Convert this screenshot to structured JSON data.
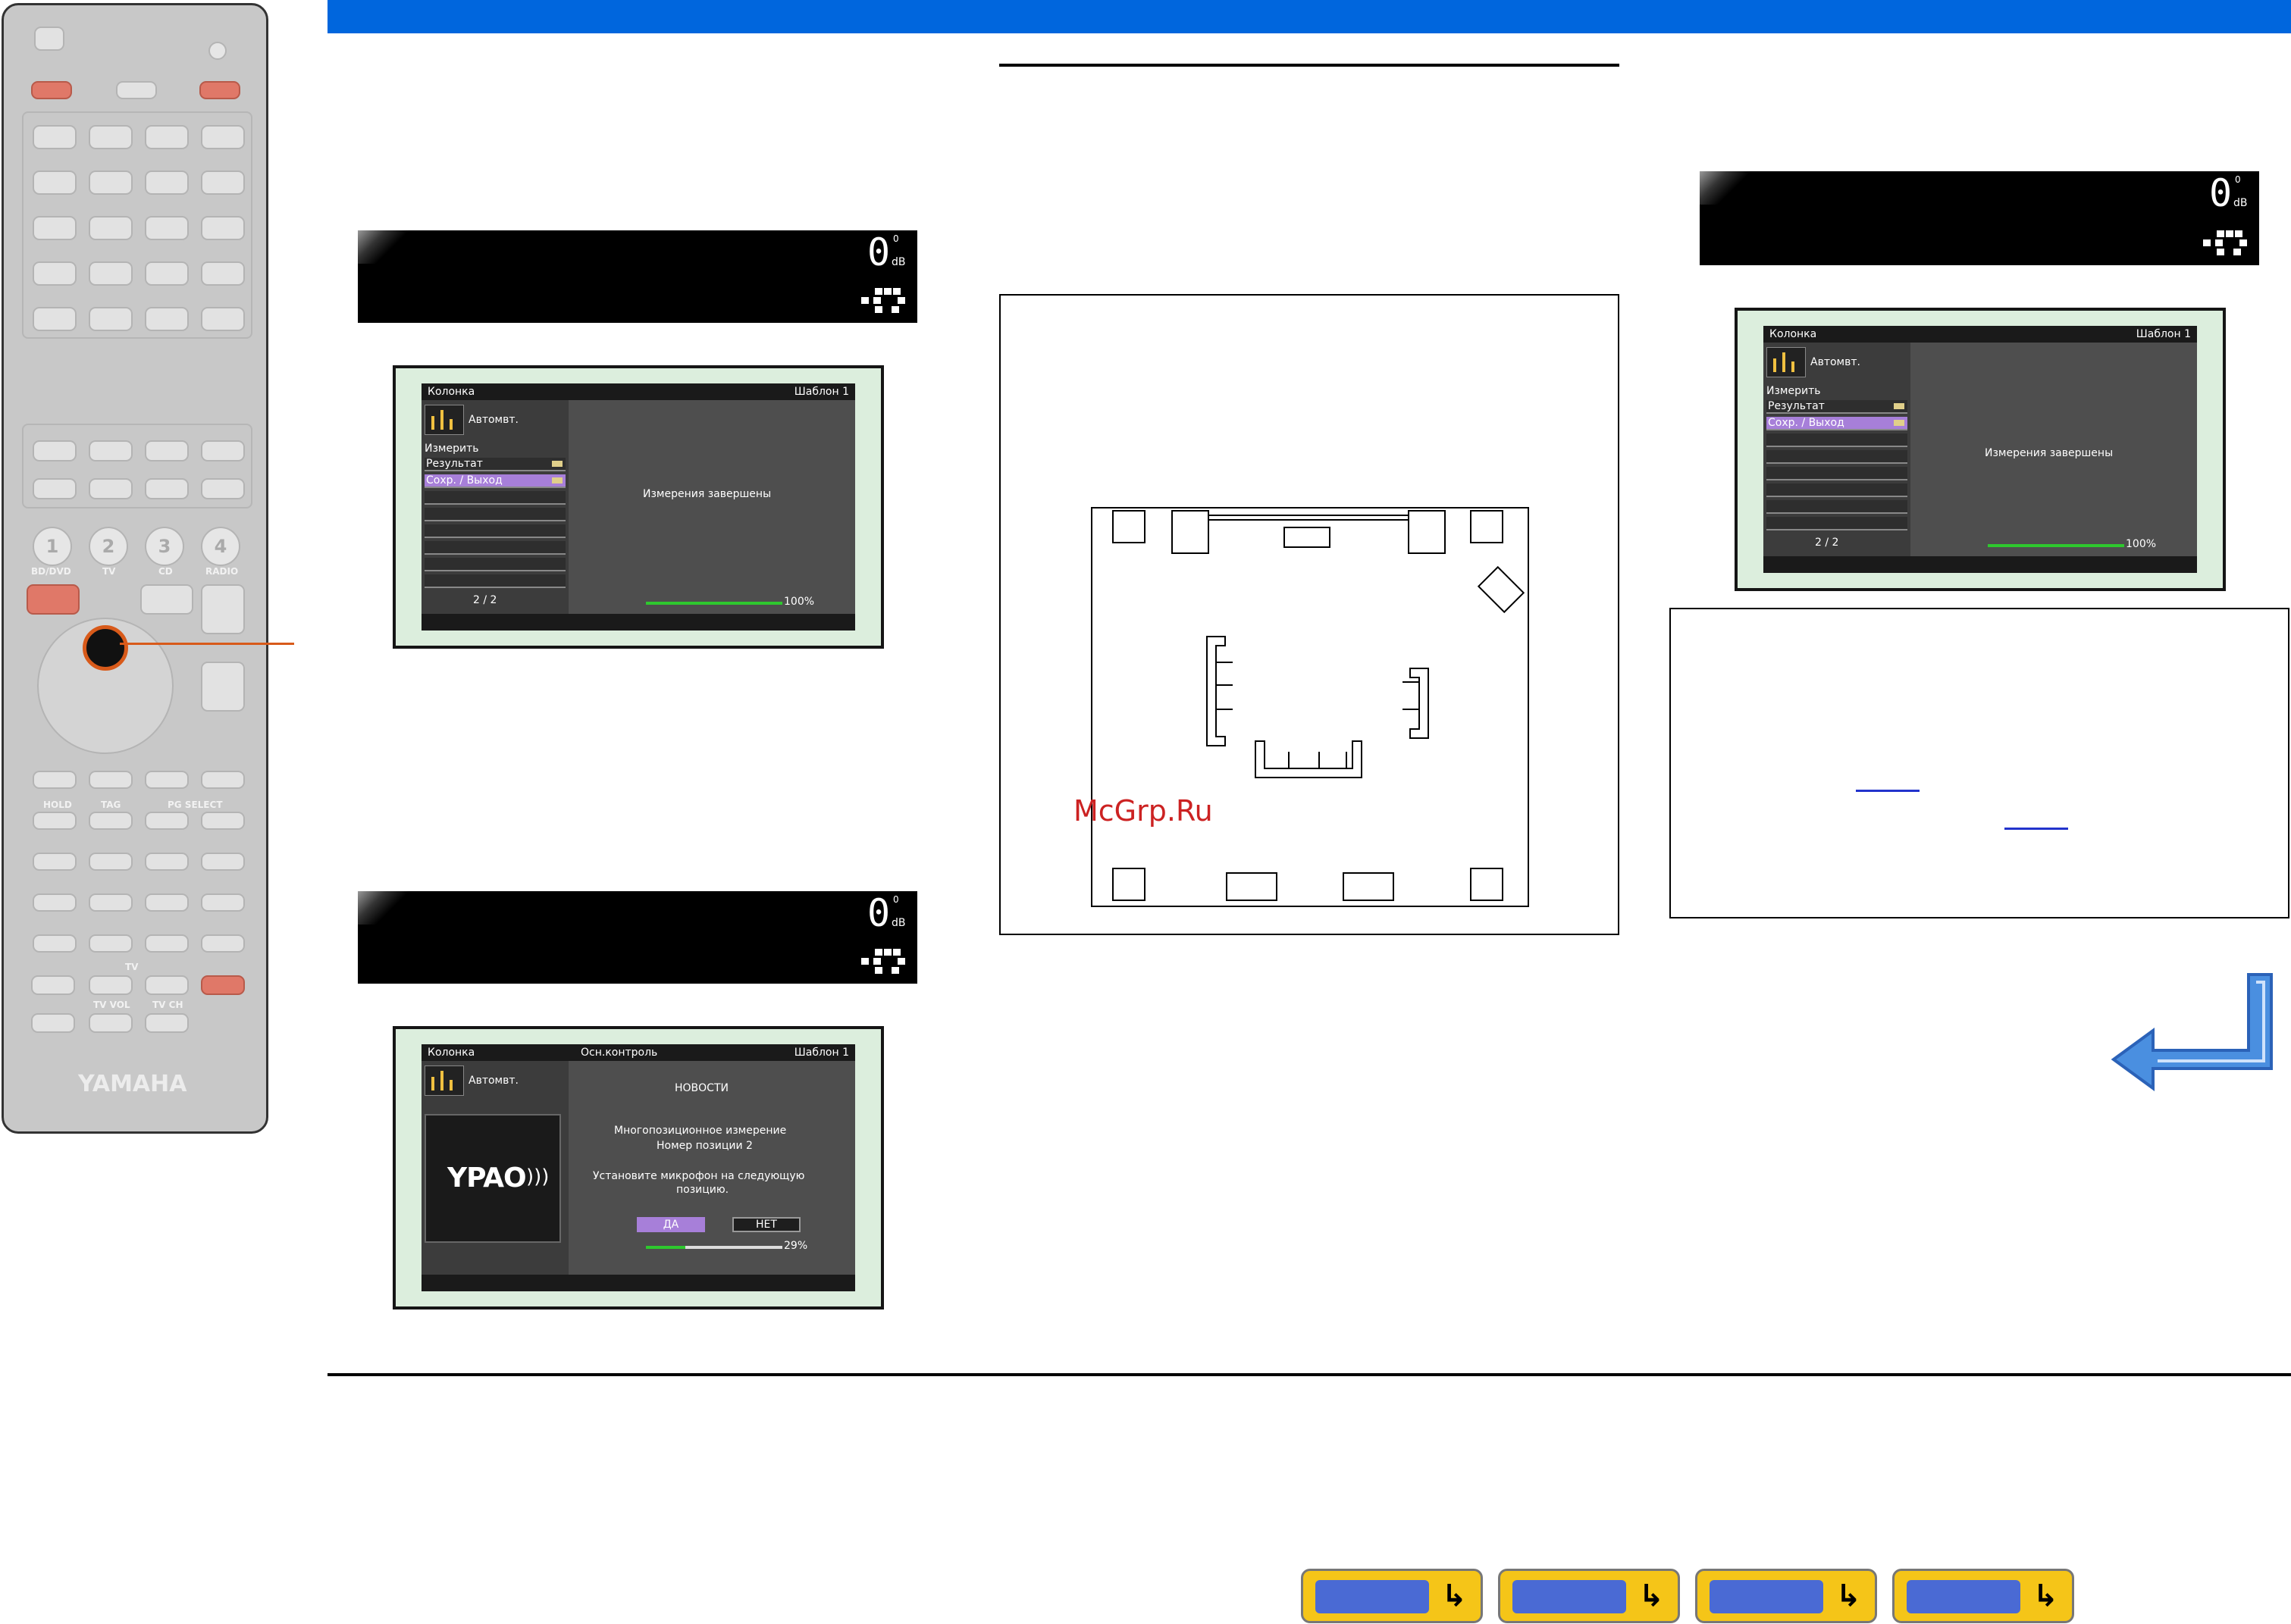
{
  "remote": {
    "brand": "YAMAHA",
    "scene_buttons": [
      "1",
      "2",
      "3",
      "4"
    ],
    "scene_labels": [
      "BD/DVD",
      "TV",
      "CD",
      "RADIO"
    ],
    "labels": {
      "hold": "HOLD",
      "tag": "TAG",
      "pg_select": "PG SELECT",
      "tv": "TV",
      "tv_vol": "TV VOL",
      "tv_ch": "TV CH"
    }
  },
  "front_display": {
    "volume": "0",
    "volume_decimal": "0",
    "unit": "dB"
  },
  "osd_result_1": {
    "header_left": "Колонка",
    "header_right": "Шаблон 1",
    "auto_label": "Автомвт.",
    "measure_label": "Измерить",
    "menu_items": [
      "Результат",
      "Сохр. / Выход"
    ],
    "page": "2 / 2",
    "message": "Измерения завершены",
    "progress_label": "100%",
    "progress": 1.0
  },
  "osd_multi": {
    "header_left": "Колонка",
    "header_center": "Осн.контроль",
    "header_right": "Шаблон 1",
    "auto_label": "Автомвт.",
    "logo": "YPAO",
    "title": "НОВОСТИ",
    "line1": "Многопозиционное измерение",
    "line2": "Номер позиции 2",
    "line3": "Установите микрофон на следующую",
    "line4": "позицию.",
    "yes": "ДА",
    "no": "НЕТ",
    "progress_label": "29%",
    "progress": 0.29
  },
  "osd_result_2": {
    "header_left": "Колонка",
    "header_right": "Шаблон 1",
    "auto_label": "Автомвт.",
    "measure_label": "Измерить",
    "menu_items": [
      "Результат",
      "Сохр. / Выход"
    ],
    "page": "2 / 2",
    "message": "Измерения завершены",
    "progress_label": "100%",
    "progress": 1.0
  },
  "watermark": "McGrp.Ru",
  "colors": {
    "top_bar": "#0066dd",
    "selected_row": "#a77fd9",
    "progress": "#2ec82e",
    "watermark": "#cc2222",
    "return_arrow": "#4a8fe0"
  },
  "icons": [
    "receiver-front-icon",
    "receiver-rear-icon",
    "receiver-grid-icon",
    "remote-icon",
    "return-arrow-icon"
  ]
}
